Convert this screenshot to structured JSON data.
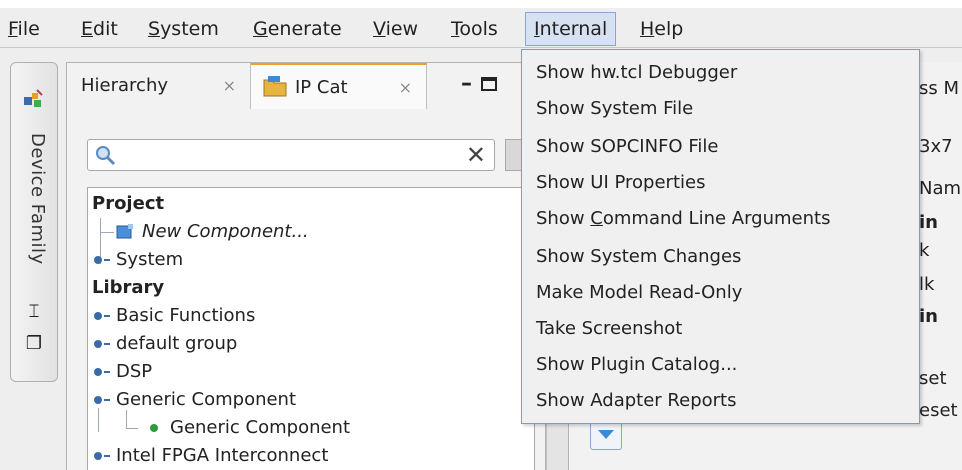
{
  "menubar": {
    "items": [
      {
        "label": "File",
        "mnemonic": "F",
        "rest": "ile"
      },
      {
        "label": "Edit",
        "mnemonic": "E",
        "rest": "dit"
      },
      {
        "label": "System",
        "mnemonic": "S",
        "rest": "ystem"
      },
      {
        "label": "Generate",
        "mnemonic": "G",
        "rest": "enerate"
      },
      {
        "label": "View",
        "mnemonic": "V",
        "rest": "iew"
      },
      {
        "label": "Tools",
        "mnemonic": "T",
        "rest": "ools"
      },
      {
        "label": "Internal",
        "mnemonic": "I",
        "rest": "nternal"
      },
      {
        "label": "Help",
        "mnemonic": "H",
        "rest": "elp"
      }
    ],
    "active": "Internal"
  },
  "internal_menu": {
    "items": [
      {
        "label": "Show hw.tcl Debugger"
      },
      {
        "label": "Show System File"
      },
      {
        "label": "Show SOPCINFO File"
      },
      {
        "label": "Show UI Properties"
      },
      {
        "pre": "Show ",
        "mnemonic": "C",
        "post": "ommand Line Arguments",
        "label": "Show Command Line Arguments"
      },
      {
        "label": "Show System Changes"
      },
      {
        "label": "Make Model Read-Only"
      },
      {
        "label": "Take Screenshot"
      },
      {
        "label": "Show Plugin Catalog..."
      },
      {
        "label": "Show Adapter Reports"
      }
    ]
  },
  "left_toolbar": {
    "label": "Device Family",
    "icons": [
      "device-family-icon",
      "pin-icon",
      "restore-icon"
    ]
  },
  "panel": {
    "tabs": [
      {
        "label": "Hierarchy",
        "close": "⨯"
      },
      {
        "label": "IP Cat",
        "close": "⨯"
      }
    ],
    "search": {
      "value": "",
      "placeholder": ""
    },
    "tree": {
      "project_header": "Project",
      "new_component": "New Component...",
      "system": "System",
      "library_header": "Library",
      "library_items": [
        "Basic Functions",
        "default group",
        "DSP",
        "Generic Component"
      ],
      "generic_child": "Generic Component",
      "last_item": "Intel FPGA Interconnect"
    }
  },
  "right_panel": {
    "fragments": [
      "ss M",
      "3x7",
      "Nam",
      "in",
      "k",
      "lk",
      "in",
      "set",
      "eset"
    ]
  },
  "colors": {
    "menu_active_bg": "#d6e2f2",
    "menu_border": "#7f9db9",
    "tab_accent": "#f0a020",
    "tree_knob": "#3a6aa8",
    "leaf_dot": "#2e9a3e"
  }
}
